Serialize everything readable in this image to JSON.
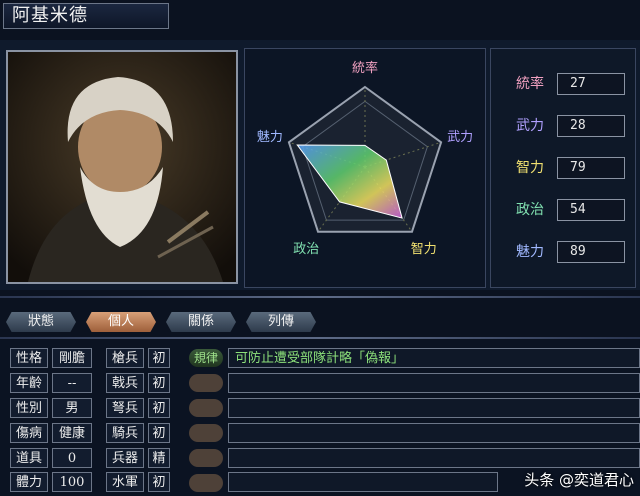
{
  "character": {
    "name": "阿基米德"
  },
  "radar": {
    "labels": [
      "統率",
      "武力",
      "智力",
      "政治",
      "魅力"
    ],
    "values": [
      27,
      28,
      79,
      54,
      89
    ],
    "max": 100,
    "label_colors": [
      "#f0a0c0",
      "#b0a0ff",
      "#f0e070",
      "#80e0b0",
      "#a0b8ff"
    ]
  },
  "stats": [
    {
      "label": "統率",
      "value": "27",
      "color": "#f0a0c0"
    },
    {
      "label": "武力",
      "value": "28",
      "color": "#b0a0ff"
    },
    {
      "label": "智力",
      "value": "79",
      "color": "#f0e070"
    },
    {
      "label": "政治",
      "value": "54",
      "color": "#80e0b0"
    },
    {
      "label": "魅力",
      "value": "89",
      "color": "#a0b8ff"
    }
  ],
  "tabs": [
    "狀態",
    "個人",
    "關係",
    "列傳"
  ],
  "active_tab": "個人",
  "personal": [
    {
      "label": "性格",
      "value": "剛膽"
    },
    {
      "label": "年齡",
      "value": "--"
    },
    {
      "label": "性別",
      "value": "男"
    },
    {
      "label": "傷病",
      "value": "健康"
    },
    {
      "label": "道具",
      "value": "0"
    },
    {
      "label": "體力",
      "value": "100"
    }
  ],
  "aptitude": [
    {
      "label": "槍兵",
      "rank": "初"
    },
    {
      "label": "戟兵",
      "rank": "初"
    },
    {
      "label": "弩兵",
      "rank": "初"
    },
    {
      "label": "騎兵",
      "rank": "初"
    },
    {
      "label": "兵器",
      "rank": "精"
    },
    {
      "label": "水軍",
      "rank": "初"
    }
  ],
  "skill": {
    "tag": "規律",
    "description": "可防止遭受部隊計略「偽報」"
  },
  "watermark": "头条 @奕道君心"
}
